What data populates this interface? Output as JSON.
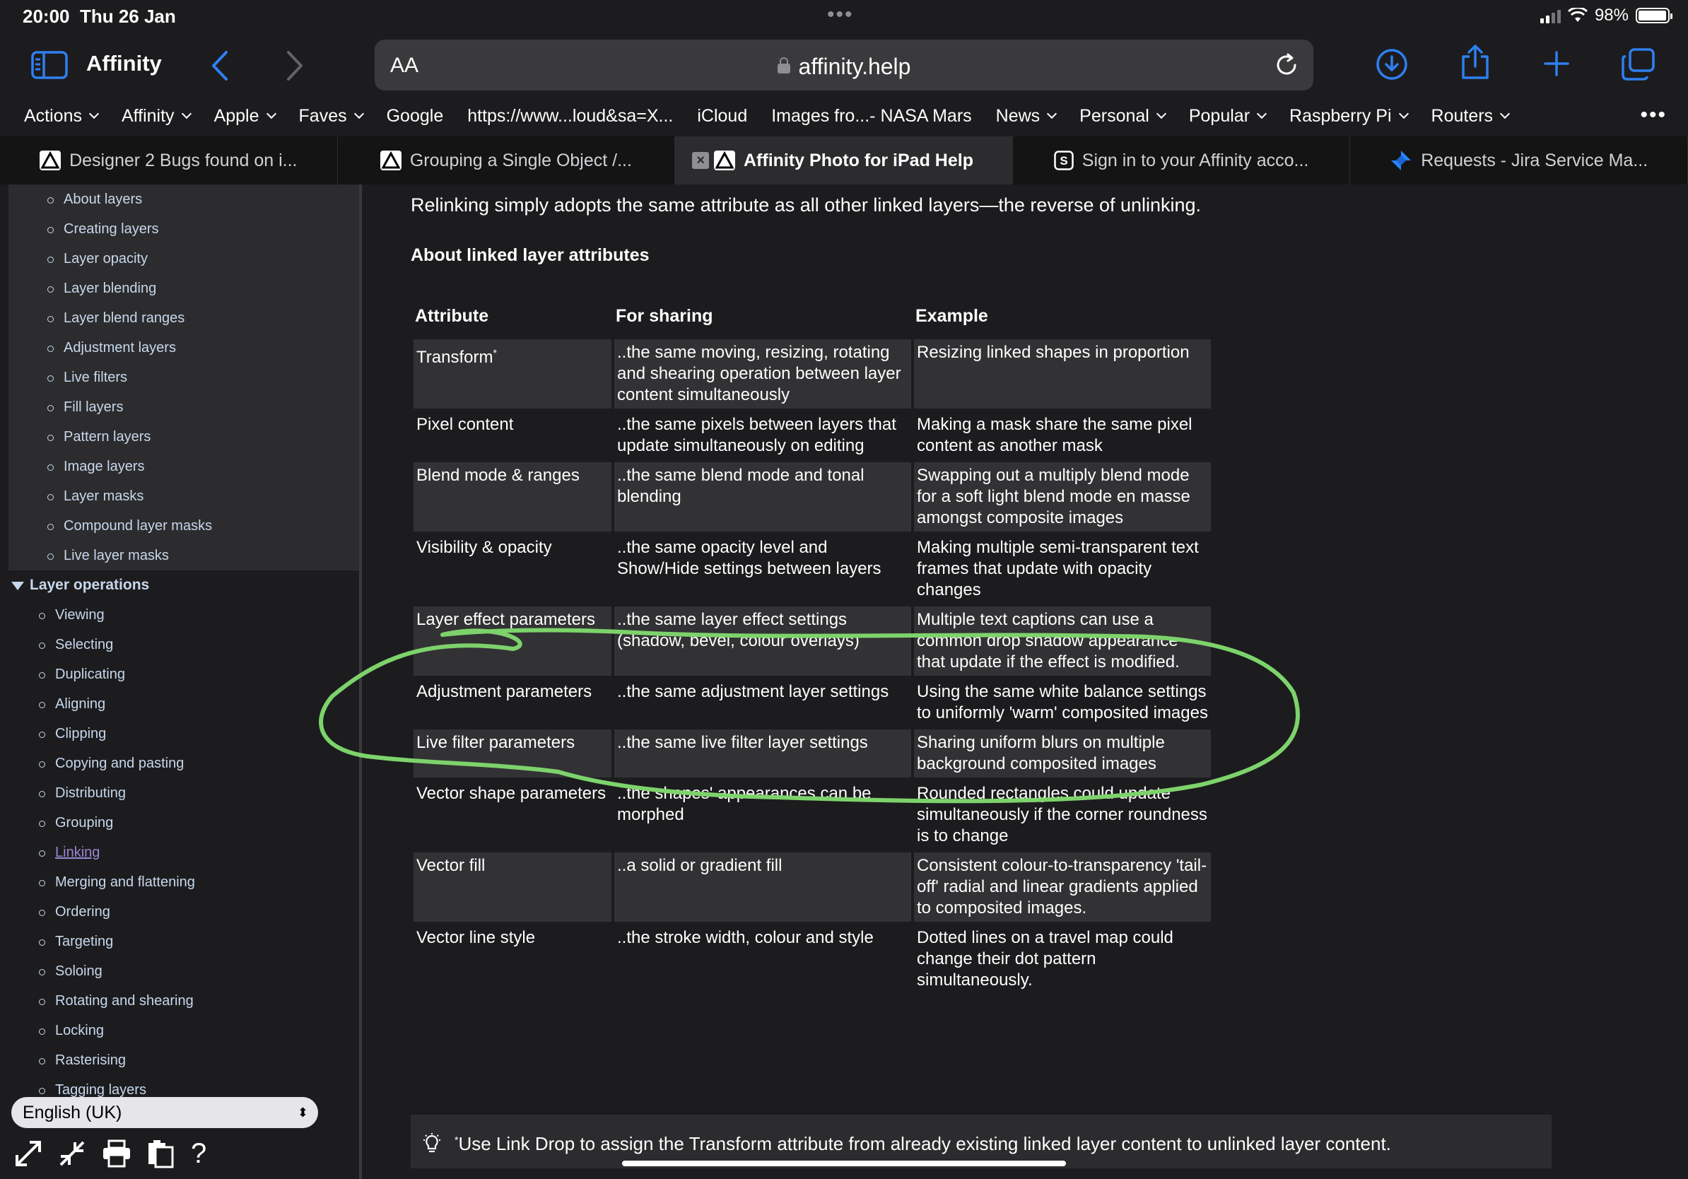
{
  "status_bar": {
    "time": "20:00",
    "date": "Thu 26 Jan",
    "battery": "98%",
    "battery_level": 0.98
  },
  "toolbar": {
    "site_title": "Affinity",
    "text_size_label": "AA",
    "url": "affinity.help"
  },
  "favorites": [
    {
      "label": "Actions",
      "has_menu": true
    },
    {
      "label": "Affinity",
      "has_menu": true
    },
    {
      "label": "Apple",
      "has_menu": true
    },
    {
      "label": "Faves",
      "has_menu": true
    },
    {
      "label": "Google",
      "has_menu": false
    },
    {
      "label": "https://www...loud&sa=X...",
      "has_menu": false
    },
    {
      "label": "iCloud",
      "has_menu": false
    },
    {
      "label": "Images fro...- NASA Mars",
      "has_menu": false
    },
    {
      "label": "News",
      "has_menu": true
    },
    {
      "label": "Personal",
      "has_menu": true
    },
    {
      "label": "Popular",
      "has_menu": true
    },
    {
      "label": "Raspberry Pi",
      "has_menu": true
    },
    {
      "label": "Routers",
      "has_menu": true
    }
  ],
  "tabs": [
    {
      "label": "Designer 2 Bugs found on i...",
      "icon": "affinity-icon",
      "active": false
    },
    {
      "label": "Grouping a Single Object /...",
      "icon": "affinity-icon",
      "active": false
    },
    {
      "label": "Affinity Photo for iPad Help",
      "icon": "affinity-icon",
      "active": true
    },
    {
      "label": "Sign in to your Affinity acco...",
      "icon": "s-icon",
      "active": false
    },
    {
      "label": "Requests - Jira Service Ma...",
      "icon": "jira-icon",
      "active": false
    }
  ],
  "sidebar": {
    "layers_items": [
      "About layers",
      "Creating layers",
      "Layer opacity",
      "Layer blending",
      "Layer blend ranges",
      "Adjustment layers",
      "Live filters",
      "Fill layers",
      "Pattern layers",
      "Image layers",
      "Layer masks",
      "Compound layer masks",
      "Live layer masks"
    ],
    "section_title": "Layer operations",
    "operations_items": [
      "Viewing",
      "Selecting",
      "Duplicating",
      "Aligning",
      "Clipping",
      "Copying and pasting",
      "Distributing",
      "Grouping",
      "Linking",
      "Merging and flattening",
      "Ordering",
      "Targeting",
      "Soloing",
      "Rotating and shearing",
      "Locking",
      "Rasterising",
      "Tagging layers"
    ],
    "current_item": "Linking",
    "language": "English (UK)"
  },
  "content": {
    "intro": "Relinking simply adopts the same attribute as all other linked layers—the reverse of unlinking.",
    "subheading": "About linked layer attributes",
    "columns": [
      "Attribute",
      "For sharing",
      "Example"
    ],
    "rows": [
      {
        "attribute": "Transform",
        "sup": "*",
        "sharing": "..the same moving, resizing, rotating and shearing operation between layer content simultaneously",
        "example": "Resizing linked shapes in proportion"
      },
      {
        "attribute": "Pixel content",
        "sup": "",
        "sharing": "..the same pixels between layers that update simultaneously on editing",
        "example": "Making a mask share the same pixel content as another mask"
      },
      {
        "attribute": "Blend mode & ranges",
        "sup": "",
        "sharing": "..the same blend mode and tonal blending",
        "example": "Swapping out a multiply blend mode for a soft light blend mode en masse amongst composite images"
      },
      {
        "attribute": "Visibility & opacity",
        "sup": "",
        "sharing": "..the same opacity level and Show/Hide settings between layers",
        "example": "Making multiple semi-transparent text frames that update with opacity changes"
      },
      {
        "attribute": "Layer effect parameters",
        "sup": "",
        "sharing": "..the same layer effect settings (shadow, bevel, colour overlays)",
        "example": "Multiple text captions can use a common drop shadow appearance that update if the effect is modified."
      },
      {
        "attribute": "Adjustment parameters",
        "sup": "",
        "sharing": "..the same adjustment layer settings",
        "example": "Using the same white balance settings to uniformly 'warm' composited images"
      },
      {
        "attribute": "Live filter parameters",
        "sup": "",
        "sharing": "..the same live filter layer settings",
        "example": "Sharing uniform blurs on multiple background composited images"
      },
      {
        "attribute": "Vector shape parameters",
        "sup": "",
        "sharing": "..the shapes' appearances can be morphed",
        "example": "Rounded rectangles could update simultaneously if the corner roundness is to change"
      },
      {
        "attribute": "Vector fill",
        "sup": "",
        "sharing": "..a solid or gradient fill",
        "example": "Consistent colour-to-transparency 'tail-off' radial and linear gradients applied to composited images."
      },
      {
        "attribute": "Vector line style",
        "sup": "",
        "sharing": "..the stroke width, colour and style",
        "example": "Dotted lines on a travel map could change their dot pattern simultaneously."
      }
    ],
    "note_sup": "*",
    "note": "Use Link Drop to assign the Transform attribute from already existing linked layer content to unlinked layer content."
  },
  "colors": {
    "annotation": "#7dd36b",
    "link_visited": "#9a86d4",
    "toc_text": "#c7d7ec",
    "accent": "#2f7ff0"
  }
}
